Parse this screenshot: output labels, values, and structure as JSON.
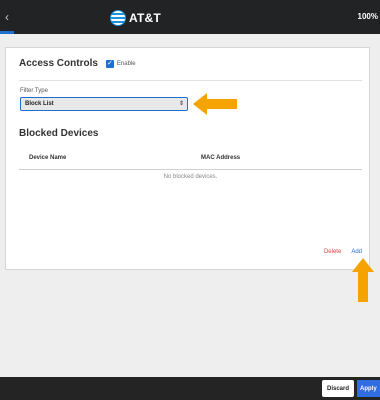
{
  "header": {
    "brand": "AT&T",
    "battery": "100%",
    "back_glyph": "‹"
  },
  "access_controls": {
    "title": "Access Controls",
    "enable_label": "Enable",
    "enable_checked": true,
    "filter_type_label": "Filter Type",
    "filter_type_value": "Block List"
  },
  "blocked_devices": {
    "title": "Blocked Devices",
    "columns": [
      "Device Name",
      "MAC Address"
    ],
    "empty_text": "No blocked devices.",
    "delete_label": "Delete",
    "add_label": "Add"
  },
  "footer": {
    "discard_label": "Discard",
    "apply_label": "Apply"
  },
  "colors": {
    "accent": "#1f6fd1",
    "annotation_arrow": "#f5a300",
    "delete": "#dd4444"
  }
}
